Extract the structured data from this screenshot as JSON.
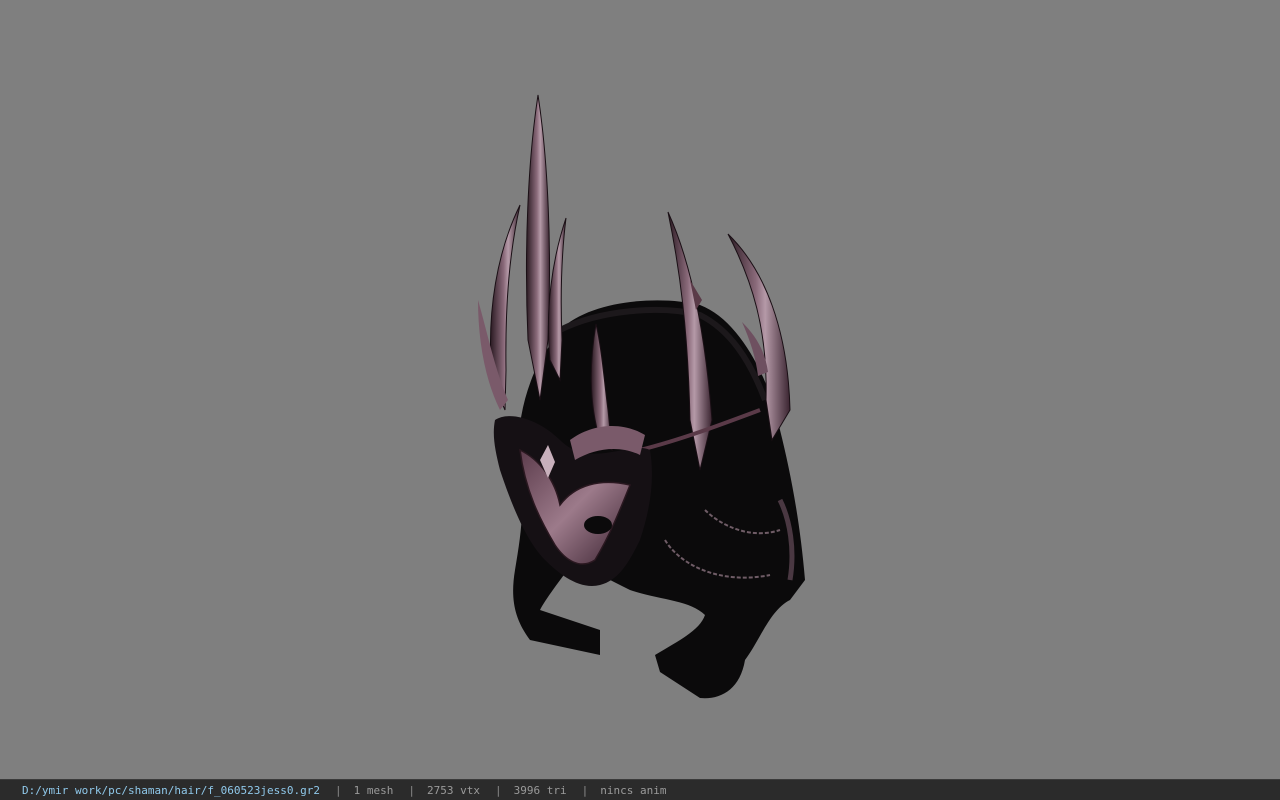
{
  "viewport": {
    "background_color": "#7f7f7f",
    "model": {
      "description_icon": "helmet-model",
      "primary_color": "#0b0a0b",
      "accent_color": "#5a3a48",
      "highlight_color": "#a98b99"
    }
  },
  "status_bar": {
    "file_path": "D:/ymir work/pc/shaman/hair/f_060523jess0.gr2",
    "separator": "|",
    "mesh_count": "1 mesh",
    "vertex_count": "2753 vtx",
    "triangle_count": "3996 tri",
    "anim_label": "nincs anim",
    "background_color": "#2b2b2b",
    "path_color": "#8fc8ea"
  }
}
